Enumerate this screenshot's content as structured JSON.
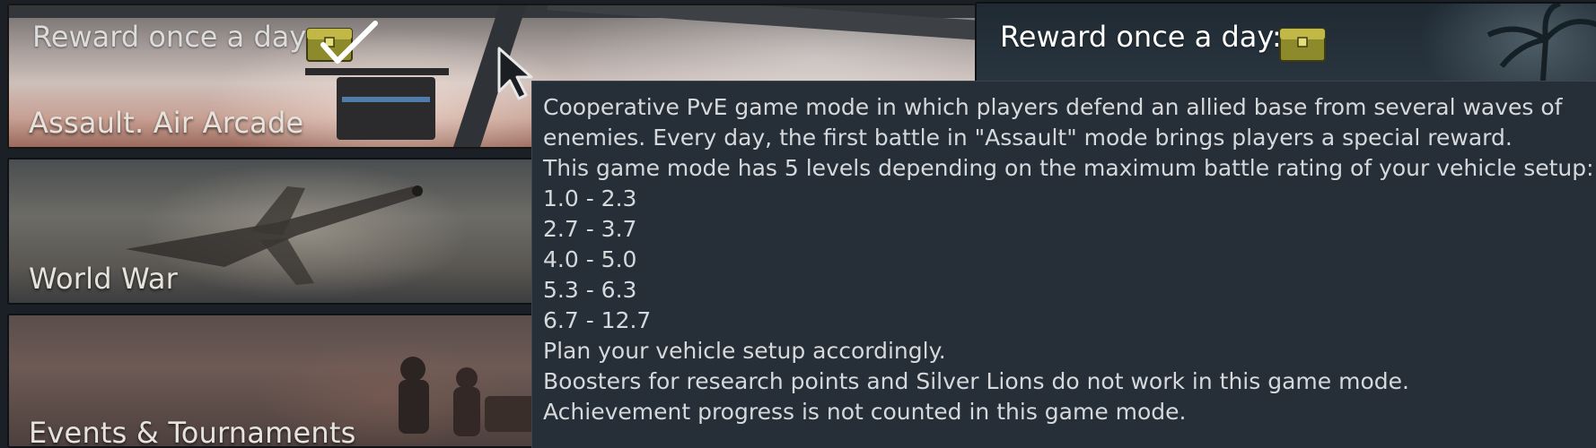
{
  "cards": [
    {
      "id": "assault",
      "label": "Assault. Air Arcade",
      "reward_text": "Reward once a day:",
      "reward_claimed": true
    },
    {
      "id": "world-war",
      "label": "World War"
    },
    {
      "id": "events",
      "label": "Events & Tournaments"
    }
  ],
  "right_card": {
    "reward_text": "Reward once a day:",
    "reward_claimed": false
  },
  "tooltip": {
    "lines": [
      "Cooperative PvE game mode in which players defend an allied base from several waves of",
      "enemies. Every day, the first battle in \"Assault\" mode brings players a special reward.",
      "This game mode has 5 levels depending on the maximum battle rating of your vehicle setup:",
      "1.0 - 2.3",
      "2.7 - 3.7",
      "4.0 - 5.0",
      "5.3 - 6.3",
      "6.7 - 12.7",
      "Plan your vehicle setup accordingly.",
      "Boosters for research points and Silver Lions do not work in this game mode.",
      "Achievement progress is not counted in this game mode."
    ]
  },
  "colors": {
    "chest": "#b0a53a",
    "tooltip_bg": "#262e37",
    "text": "#d6d9dc"
  },
  "icons": {
    "chest": "chest-icon",
    "checkmark": "checkmark-icon",
    "cursor": "mouse-cursor-icon"
  }
}
